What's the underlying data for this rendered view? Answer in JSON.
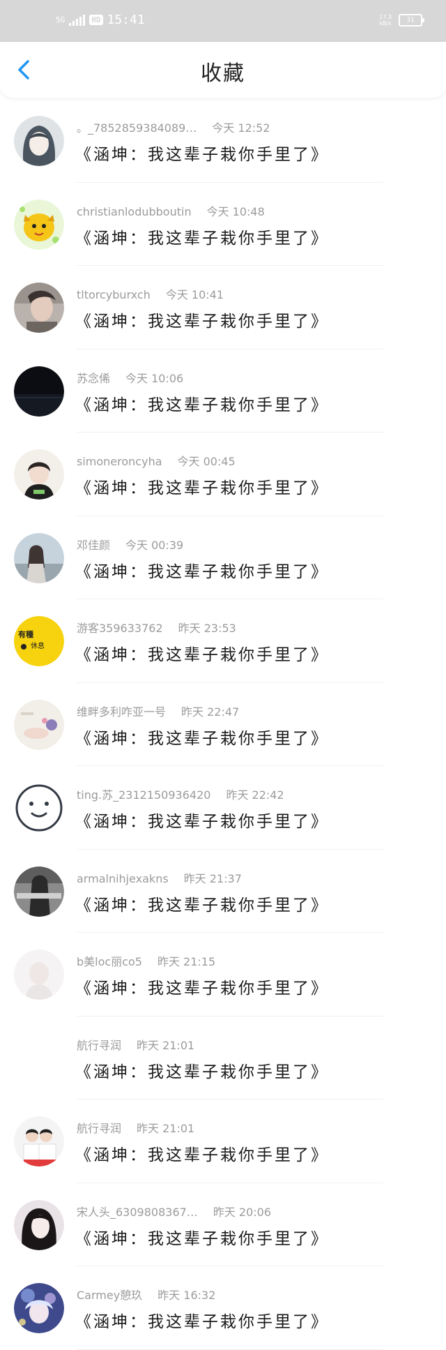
{
  "status_bar": {
    "network": "5G",
    "hd": "HD",
    "time": "15:41",
    "speed_value": "17.3",
    "speed_unit": "kB/s",
    "battery": "31"
  },
  "header": {
    "title": "收藏",
    "back_icon": "chevron-left-icon",
    "accent_color": "#2196f3"
  },
  "items": [
    {
      "user": "。_7852859384089…",
      "time": "今天 12:52",
      "content": "《涵坤：我这辈子栽你手里了》",
      "avatar": "anime-girl"
    },
    {
      "user": "christianlodubboutin",
      "time": "今天 10:48",
      "content": "《涵坤：我这辈子栽你手里了》",
      "avatar": "yellow-cartoon"
    },
    {
      "user": "tltorcyburxch",
      "time": "今天 10:41",
      "content": "《涵坤：我这辈子栽你手里了》",
      "avatar": "photo-person"
    },
    {
      "user": "苏念俙",
      "time": "今天 10:06",
      "content": "《涵坤：我这辈子栽你手里了》",
      "avatar": "dark-night"
    },
    {
      "user": "simoneroncyha",
      "time": "今天 00:45",
      "content": "《涵坤：我这辈子栽你手里了》",
      "avatar": "girl-photo"
    },
    {
      "user": "邓佳颜",
      "time": "今天 00:39",
      "content": "《涵坤：我这辈子栽你手里了》",
      "avatar": "outdoor-girl"
    },
    {
      "user": "游客359633762",
      "time": "昨天 23:53",
      "content": "《涵坤：我这辈子栽你手里了》",
      "avatar": "yellow-sticker",
      "avatar_text_1": "有種",
      "avatar_text_2": "休息"
    },
    {
      "user": "维畔多利咋亚一号",
      "time": "昨天 22:47",
      "content": "《涵坤：我这辈子栽你手里了》",
      "avatar": "light-photo"
    },
    {
      "user": "ting.苏_2312150936420",
      "time": "昨天 22:42",
      "content": "《涵坤：我这辈子栽你手里了》",
      "avatar": "smiley-face"
    },
    {
      "user": "armalnihjexakns",
      "time": "昨天 21:37",
      "content": "《涵坤：我这辈子栽你手里了》",
      "avatar": "bw-photo"
    },
    {
      "user": "b美loc丽co5",
      "time": "昨天 21:15",
      "content": "《涵坤：我这辈子栽你手里了》",
      "avatar": "faded-photo"
    },
    {
      "user": "航行寻润",
      "time": "昨天 21:01",
      "content": "《涵坤：我这辈子栽你手里了》",
      "avatar": "none"
    },
    {
      "user": "航行寻润",
      "time": "昨天 21:01",
      "content": "《涵坤：我这辈子栽你手里了》",
      "avatar": "two-kids"
    },
    {
      "user": "宋人头_6309808367…",
      "time": "昨天 20:06",
      "content": "《涵坤：我这辈子栽你手里了》",
      "avatar": "anime-portrait"
    },
    {
      "user": "Carmey憩玖",
      "time": "昨天 16:32",
      "content": "《涵坤：我这辈子栽你手里了》",
      "avatar": "fantasy-art"
    }
  ]
}
